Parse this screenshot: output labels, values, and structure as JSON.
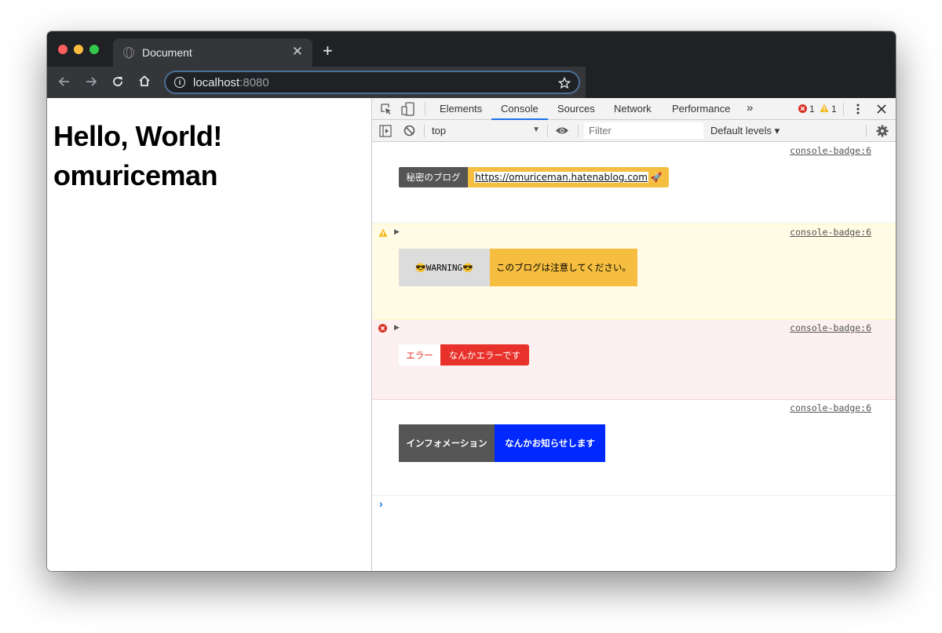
{
  "browser": {
    "tab_title": "Document",
    "tab_close": "✕",
    "new_tab": "+",
    "url_host": "localhost",
    "url_port": ":8080"
  },
  "page": {
    "heading1": "Hello, World!",
    "heading2": "omuriceman"
  },
  "devtools": {
    "tabs": [
      "Elements",
      "Console",
      "Sources",
      "Network",
      "Performance"
    ],
    "more_tabs": "»",
    "error_count": "1",
    "warning_count": "1",
    "context": "top",
    "filter_placeholder": "Filter",
    "levels": "Default levels ▾"
  },
  "console": {
    "messages": [
      {
        "level": "log",
        "source": "console-badge:6",
        "left_label": "秘密のブログ",
        "right_label": "https://omuriceman.hatenablog.com",
        "emoji": "🚀"
      },
      {
        "level": "warning",
        "source": "console-badge:6",
        "left_label": "😎WARNING😎",
        "right_label": "このブログは注意してください。"
      },
      {
        "level": "error",
        "source": "console-badge:6",
        "left_label": "エラー",
        "right_label": "なんかエラーです"
      },
      {
        "level": "info",
        "source": "console-badge:6",
        "left_label": "インフォメーション",
        "right_label": "なんかお知らせします"
      }
    ],
    "prompt": "›"
  },
  "colors": {
    "badge_dark": "#555555",
    "badge_yellow": "#f6be40",
    "warning_bg": "#fffbe5",
    "error_bg": "#fcf0f0",
    "error_red": "#e8312a",
    "info_blue": "#0028ff"
  }
}
